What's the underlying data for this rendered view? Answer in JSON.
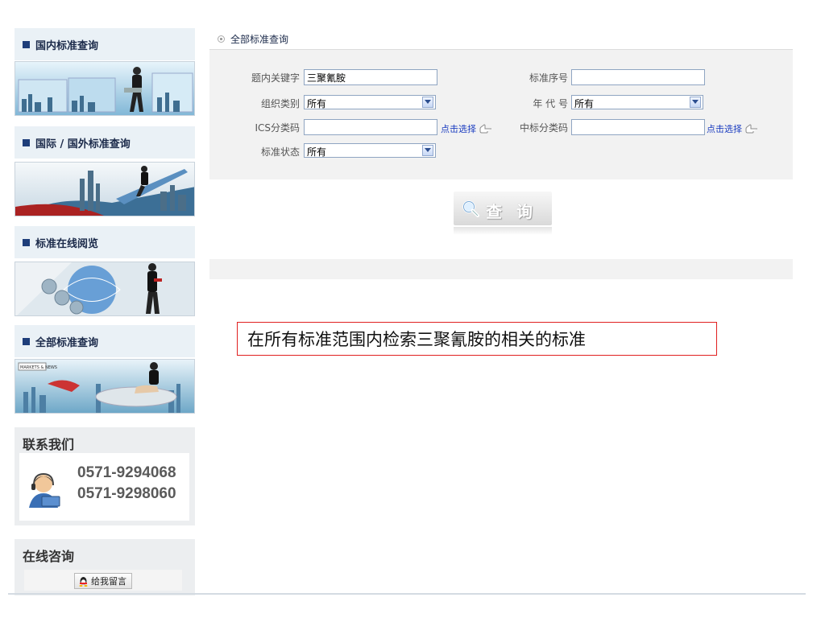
{
  "sidebar": {
    "sections": [
      {
        "title": "国内标准查询"
      },
      {
        "title": "国际 / 国外标准查询"
      },
      {
        "title": "标准在线阅览"
      },
      {
        "title": "全部标准查询"
      }
    ],
    "banner_badge": "MARKETS & NEWS",
    "contact": {
      "title": "联系我们",
      "phones": [
        "0571-9294068",
        "0571-9298060"
      ]
    },
    "consult": {
      "title": "在线咨询",
      "message_button": "给我留言"
    }
  },
  "form": {
    "panel_title": "全部标准查询",
    "keyword": {
      "label": "题内关键字",
      "value": "三聚氰胺"
    },
    "serial": {
      "label": "标准序号",
      "value": ""
    },
    "org": {
      "label": "组织类别",
      "selected": "所有"
    },
    "year": {
      "label": "年 代 号",
      "selected": "所有"
    },
    "ics": {
      "label": "ICS分类码",
      "value": "",
      "pick": "点击选择"
    },
    "ccs": {
      "label": "中标分类码",
      "value": "",
      "pick": "点击选择"
    },
    "status": {
      "label": "标准状态",
      "selected": "所有"
    },
    "search_button": "查询"
  },
  "annotation": "在所有标准范围内检索三聚氰胺的相关的标准",
  "colors": {
    "accent": "#1e3e7a",
    "panel_bg": "#f2f2f2",
    "link": "#1a3cc0",
    "note_border": "#e02020"
  }
}
